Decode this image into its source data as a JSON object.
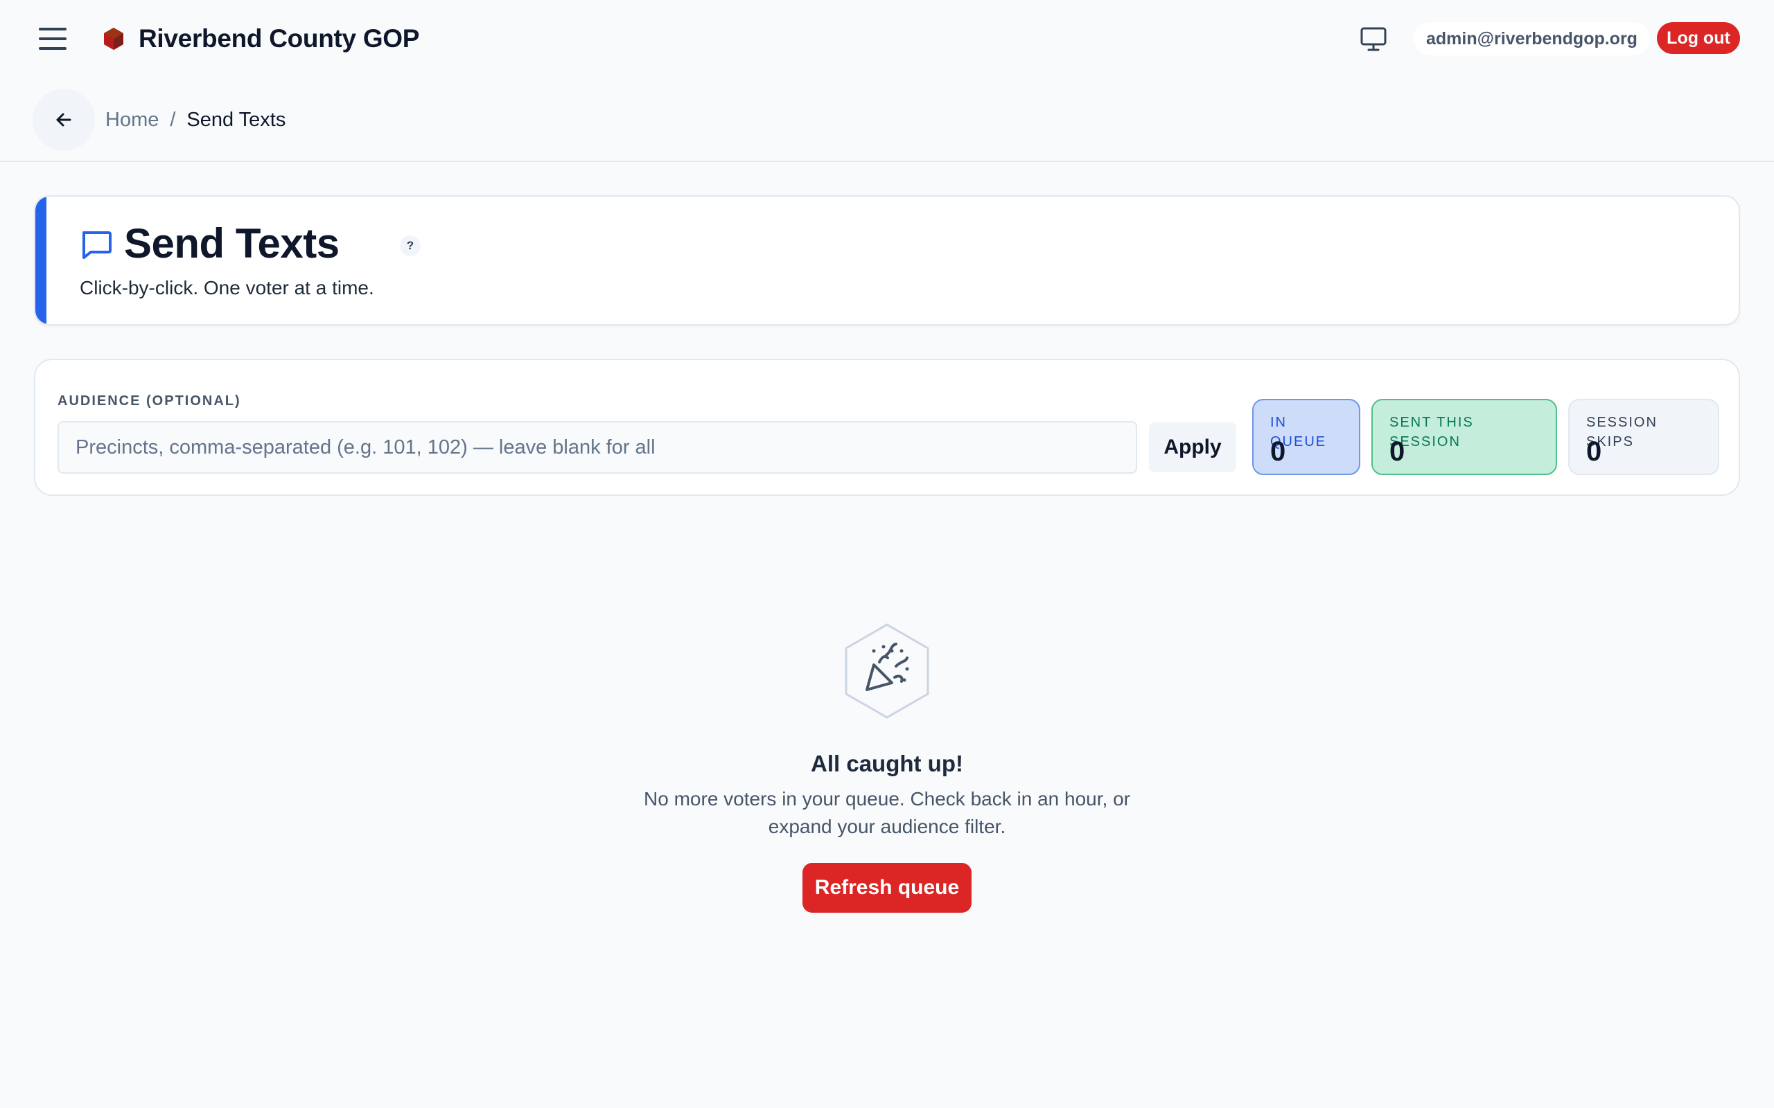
{
  "header": {
    "brand_name": "Riverbend County GOP",
    "user_email": "admin@riverbendgop.org",
    "logout_label": "Log out",
    "icons": [
      "menu-icon",
      "hexagon-logo-icon",
      "monitor-icon"
    ]
  },
  "breadcrumb": {
    "home": "Home",
    "separator": "/",
    "current": "Send Texts"
  },
  "page": {
    "title": "Send Texts",
    "help": "?",
    "subtitle": "Click-by-click. One voter at a time.",
    "accent_color": "#2563eb"
  },
  "audience": {
    "label": "AUDIENCE (OPTIONAL)",
    "value": "",
    "placeholder": "Precincts, comma-separated (e.g. 101, 102) — leave blank for all",
    "apply_label": "Apply"
  },
  "stats": {
    "queue": {
      "label": "IN QUEUE",
      "value": "0"
    },
    "sent": {
      "label": "SENT THIS SESSION",
      "value": "0"
    },
    "skips": {
      "label": "SESSION SKIPS",
      "value": "0"
    }
  },
  "empty_state": {
    "icon": "party-popper-icon",
    "title": "All caught up!",
    "description": "No more voters in your queue. Check back in an hour, or expand your audience filter.",
    "button_label": "Refresh queue"
  },
  "colors": {
    "danger": "#dc2626",
    "primary": "#2563eb"
  }
}
